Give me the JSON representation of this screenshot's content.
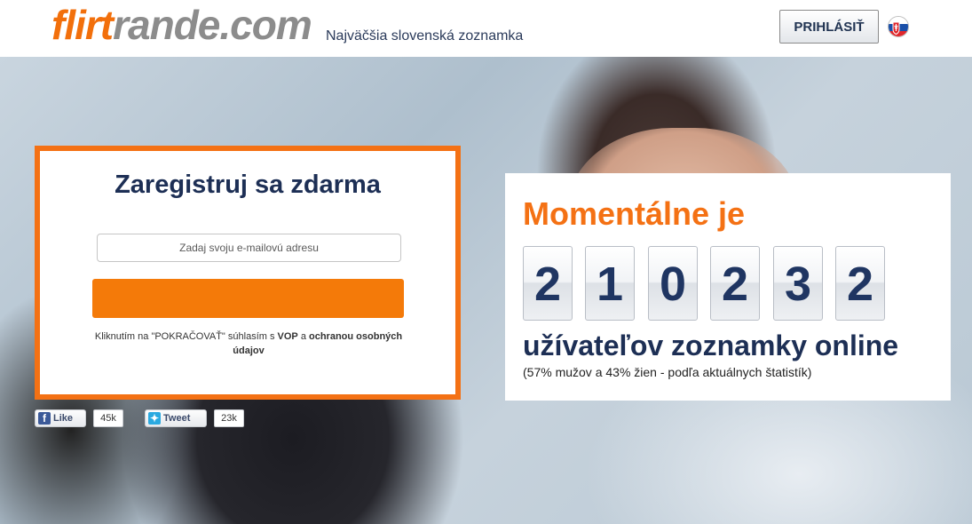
{
  "header": {
    "logo_part1": "flirt",
    "logo_part2": "rande.com",
    "tagline": "Najväčšia slovenská zoznamka",
    "login_label": "PRIHLÁSIŤ",
    "flag_icon": "slovak-flag-icon"
  },
  "registration": {
    "title": "Zaregistruj sa zdarma",
    "email_placeholder": "Zadaj svoju e-mailovú adresu",
    "continue_label": "",
    "terms_prefix": "Kliknutím na \"POKRAČOVAŤ\" súhlasím s ",
    "terms_vop": "VOP",
    "terms_and": " a ",
    "terms_privacy": "ochranou osobných údajov",
    "accent_color": "#f47114"
  },
  "social": {
    "like_label": "Like",
    "like_count": "45k",
    "tweet_label": "Tweet",
    "tweet_count": "23k"
  },
  "stats": {
    "heading": "Momentálne je",
    "digits": [
      "2",
      "1",
      "0",
      "2",
      "3",
      "2"
    ],
    "users_text": "užívateľov zoznamky online",
    "users_subtext": "(57% mužov a 43% žien - podľa aktuálnych štatistík)"
  }
}
